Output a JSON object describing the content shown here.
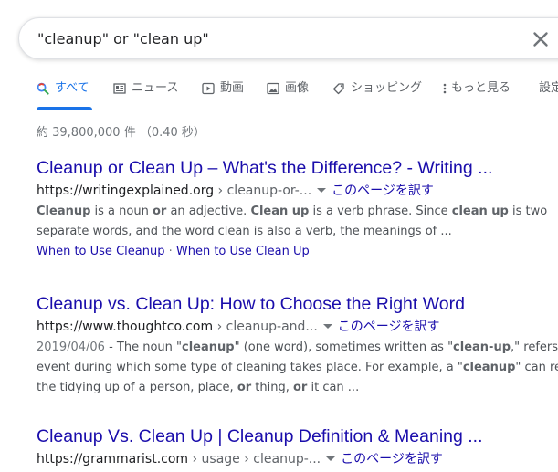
{
  "search": {
    "query": "\"cleanup\" or \"clean up\""
  },
  "tabs": [
    {
      "label": "すべて"
    },
    {
      "label": "ニュース"
    },
    {
      "label": "動画"
    },
    {
      "label": "画像"
    },
    {
      "label": "ショッピング"
    },
    {
      "label": "もっと見る"
    },
    {
      "label": "設定"
    }
  ],
  "stats": "約 39,800,000 件 （0.40 秒）",
  "colors": {
    "accent": "#1a73e8",
    "link": "#1a0dab"
  },
  "results": [
    {
      "title": "Cleanup or Clean Up – What's the Difference? - Writing ...",
      "domain": "https://writingexplained.org",
      "path": " › cleanup-or-...",
      "translate": "このページを訳す",
      "snippet1": [
        {
          "t": "Cleanup",
          "b": true
        },
        {
          "t": " is a noun ",
          "b": false
        },
        {
          "t": "or",
          "b": true
        },
        {
          "t": " an adjective. ",
          "b": false
        },
        {
          "t": "Clean up",
          "b": true
        },
        {
          "t": " is a verb phrase. Since ",
          "b": false
        },
        {
          "t": "clean up",
          "b": true
        },
        {
          "t": " is two",
          "b": false
        }
      ],
      "snippet2": "separate words, and the word clean is also a verb, the meanings of ...",
      "sitelinks": [
        "When to Use Cleanup",
        "When to Use Clean Up"
      ]
    },
    {
      "title": "Cleanup vs. Clean Up: How to Choose the Right Word",
      "domain": "https://www.thoughtco.com",
      "path": " › cleanup-and...",
      "translate": "このページを訳す",
      "date": "2019/04/06",
      "snippet1": [
        {
          "t": " - The noun \"",
          "b": false
        },
        {
          "t": "cleanup",
          "b": true
        },
        {
          "t": "\" (one word), sometimes written as \"",
          "b": false
        },
        {
          "t": "clean-up",
          "b": true
        },
        {
          "t": ",\" refers to a",
          "b": false
        }
      ],
      "snippet2": [
        {
          "t": "event during which some type of cleaning takes place. For example, a \"",
          "b": false
        },
        {
          "t": "cleanup",
          "b": true
        },
        {
          "t": "\" can refer",
          "b": false
        }
      ],
      "snippet3": [
        {
          "t": "the tidying up of a person, place, ",
          "b": false
        },
        {
          "t": "or",
          "b": true
        },
        {
          "t": " thing, ",
          "b": false
        },
        {
          "t": "or",
          "b": true
        },
        {
          "t": " it can ...",
          "b": false
        }
      ]
    },
    {
      "title": "Cleanup Vs. Clean Up | Cleanup Definition & Meaning ...",
      "domain": "https://grammarist.com",
      "path": " › usage › cleanup-...",
      "translate": "このページを訳す"
    }
  ]
}
